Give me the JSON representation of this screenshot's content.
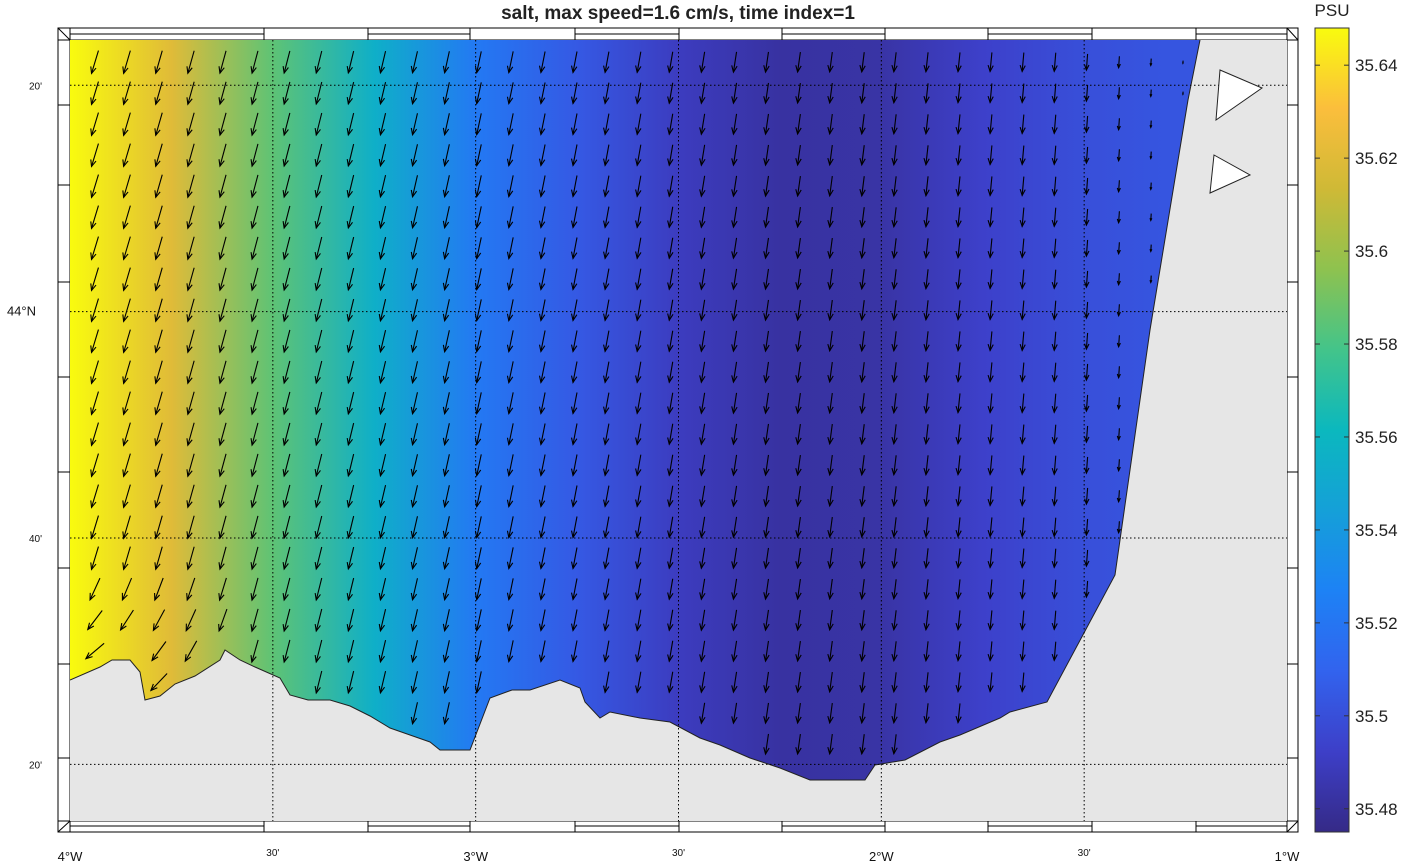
{
  "title": "salt, max speed=1.6 cm/s, time index=1",
  "colors": {
    "land": "#e6e6e6",
    "coast_stroke": "#222222",
    "grid": "#000000",
    "arrow": "#000000"
  },
  "chart_data": {
    "type": "heatmap",
    "title": "salt, max speed=1.6 cm/s, time index=1",
    "projection": "map",
    "xlim": [
      -4.0,
      -1.0
    ],
    "ylim": [
      43.25,
      44.4
    ],
    "grid": true,
    "x_ticks": [
      {
        "value": -4.0,
        "label": "4°W",
        "major": true
      },
      {
        "value": -3.5,
        "label": "30'",
        "major": false
      },
      {
        "value": -3.0,
        "label": "3°W",
        "major": true
      },
      {
        "value": -2.5,
        "label": "30'",
        "major": false
      },
      {
        "value": -2.0,
        "label": "2°W",
        "major": true
      },
      {
        "value": -1.5,
        "label": "30'",
        "major": false
      },
      {
        "value": -1.0,
        "label": "1°W",
        "major": true
      }
    ],
    "y_ticks": [
      {
        "value": 43.3333,
        "label": "20'",
        "major": false
      },
      {
        "value": 43.6667,
        "label": "40'",
        "major": false
      },
      {
        "value": 44.0,
        "label": "44°N",
        "major": true
      },
      {
        "value": 44.3333,
        "label": "20'",
        "major": false
      }
    ],
    "colorbar": {
      "label": "PSU",
      "colormap": "parula",
      "clim": [
        35.475,
        35.648
      ],
      "ticks": [
        35.48,
        35.5,
        35.52,
        35.54,
        35.56,
        35.58,
        35.6,
        35.62,
        35.64
      ]
    },
    "salinity_profile_by_longitude": [
      {
        "lon": -4.0,
        "psu": 35.648
      },
      {
        "lon": -3.75,
        "psu": 35.62
      },
      {
        "lon": -3.5,
        "psu": 35.585
      },
      {
        "lon": -3.25,
        "psu": 35.555
      },
      {
        "lon": -3.0,
        "psu": 35.522
      },
      {
        "lon": -2.75,
        "psu": 35.505
      },
      {
        "lon": -2.5,
        "psu": 35.49
      },
      {
        "lon": -2.25,
        "psu": 35.482
      },
      {
        "lon": -2.0,
        "psu": 35.483
      },
      {
        "lon": -1.75,
        "psu": 35.493
      },
      {
        "lon": -1.5,
        "psu": 35.5
      },
      {
        "lon": -1.3,
        "psu": 35.503
      }
    ],
    "max_speed_cm_s": 1.6,
    "current_field": {
      "dominant_direction": "southward, slightly westward",
      "note": "weaker currents near the eastern coast; south-westward turning along the southern coast"
    }
  }
}
